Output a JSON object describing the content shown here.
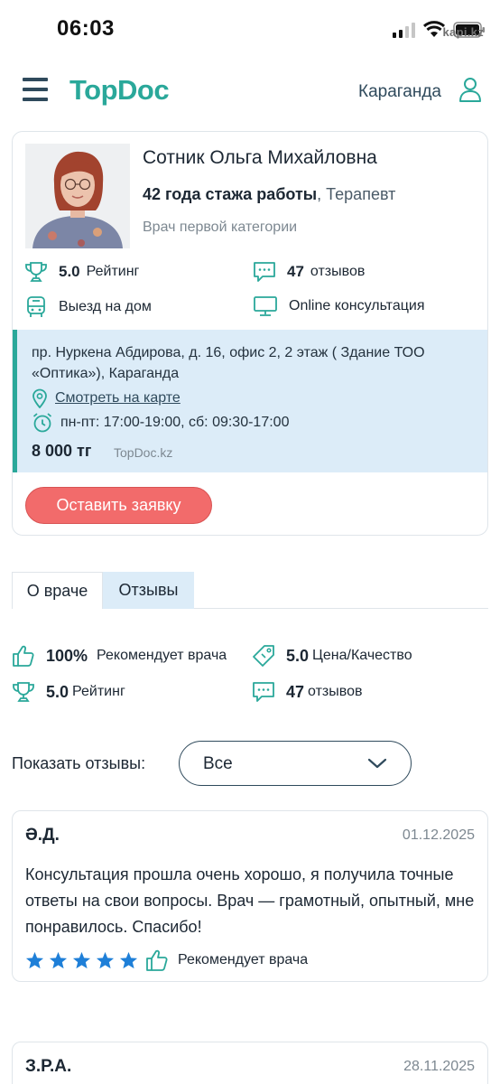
{
  "status_bar": {
    "time": "06:03",
    "watermark": "kapi.kz"
  },
  "header": {
    "logo": "TopDoc",
    "city": "Караганда",
    "icons": [
      "menu-icon",
      "user-icon"
    ]
  },
  "doctor": {
    "name": "Сотник Ольга Михайловна",
    "experience": "42 года стажа работы",
    "specialty": ", Терапевт",
    "category": "Врач первой категории",
    "rating_value": "5.0",
    "rating_label": "Рейтинг",
    "reviews_count": "47",
    "reviews_label": "отзывов",
    "home_visit": "Выезд на дом",
    "online": "Online консультация",
    "address": "пр. Нуркена Абдирова, д. 16, офис 2, 2 этаж ( Здание ТОО «Оптика»), Караганда",
    "map_link": "Смотреть на карте",
    "hours": "пн-пт: 17:00-19:00, сб: 09:30-17:00",
    "price": "8 000 тг",
    "price_source": "TopDoc.kz",
    "cta": "Оставить заявку"
  },
  "tabs": [
    {
      "label": "О враче",
      "active": false
    },
    {
      "label": "Отзывы",
      "active": true
    }
  ],
  "summary": {
    "recommend_value": "100%",
    "recommend_label": "Рекомендует врача",
    "price_quality_value": "5.0",
    "price_quality_label": "Цена/Качество",
    "rating_value": "5.0",
    "rating_label": "Рейтинг",
    "reviews_count": "47",
    "reviews_label": "отзывов"
  },
  "filter": {
    "label": "Показать отзывы:",
    "value": "Все"
  },
  "reviews": [
    {
      "author": "Ә.Д.",
      "date": "01.12.2025",
      "text": "Консультация прошла очень хорошо, я получила точные ответы на свои вопросы. Врач — грамотный, опытный, мне понравилось. Спасибо!",
      "stars": 5,
      "recommend": "Рекомендует врача"
    },
    {
      "author": "З.Р.А.",
      "date": "28.11.2025"
    }
  ],
  "colors": {
    "brand": "#2aa89a",
    "cta": "#f26b6b",
    "info_bg": "#dcecf8",
    "star": "#1e7fd8",
    "text": "#1c2733"
  }
}
